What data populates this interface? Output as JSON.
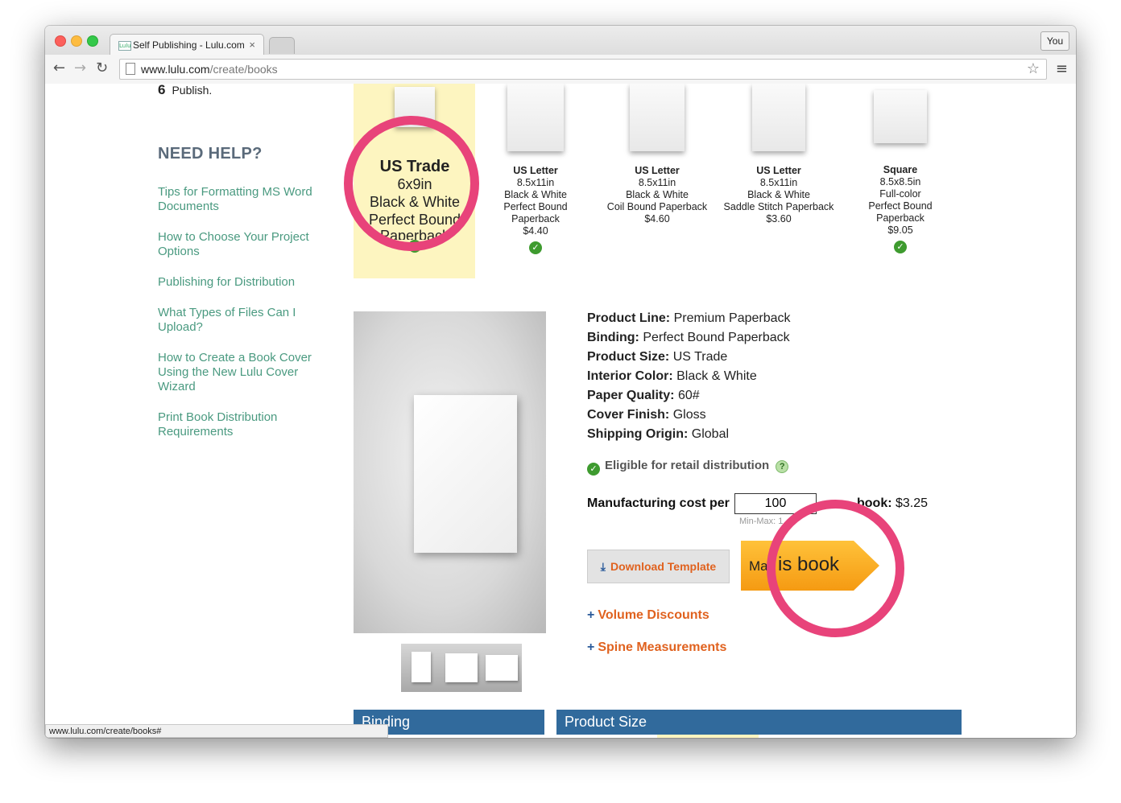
{
  "browser": {
    "tab_title": "Self Publishing - Lulu.com",
    "favicon_text": "Lulu",
    "profile_label": "You",
    "url_host": "www.lulu.com",
    "url_path": "/create/books",
    "status_url": "www.lulu.com/create/books#"
  },
  "steps": {
    "number": "6",
    "label": "Publish."
  },
  "help": {
    "title": "NEED HELP?",
    "links": [
      "Tips for Formatting MS Word Documents",
      "How to Choose Your Project Options",
      "Publishing for Distribution",
      "What Types of Files Can I Upload?",
      "How to Create a Book Cover Using the New Lulu Cover Wizard",
      "Print Book Distribution Requirements"
    ]
  },
  "products": [
    {
      "name": "US Trade",
      "size": "6x9in",
      "color": "Black & White",
      "binding": "Perfect Bound",
      "binding2": "Paperback",
      "price": "",
      "selected": true
    },
    {
      "name": "US Letter",
      "size": "8.5x11in",
      "color": "Black & White",
      "binding": "Perfect Bound",
      "binding2": "Paperback",
      "price": "$4.40"
    },
    {
      "name": "US Letter",
      "size": "8.5x11in",
      "color": "Black & White",
      "binding": "Coil Bound Paperback",
      "binding2": "",
      "price": "$4.60"
    },
    {
      "name": "US Letter",
      "size": "8.5x11in",
      "color": "Black & White",
      "binding": "Saddle Stitch Paperback",
      "binding2": "",
      "price": "$3.60"
    },
    {
      "name": "Square",
      "size": "8.5x8.5in",
      "color": "Full-color",
      "binding": "Perfect Bound",
      "binding2": "Paperback",
      "price": "$9.05"
    }
  ],
  "specs": {
    "product_line_label": "Product Line:",
    "product_line": "Premium Paperback",
    "binding_label": "Binding:",
    "binding": "Perfect Bound Paperback",
    "size_label": "Product Size:",
    "size": "US Trade",
    "interior_label": "Interior Color:",
    "interior": "Black & White",
    "paper_label": "Paper Quality:",
    "paper": "60#",
    "finish_label": "Cover Finish:",
    "finish": "Gloss",
    "origin_label": "Shipping Origin:",
    "origin": "Global"
  },
  "eligible": "Eligible for retail distribution",
  "help_q": "?",
  "cost": {
    "label": "Manufacturing cost per",
    "quantity": "100",
    "minmax": "Min-Max: 1",
    "per_book_label": "book:",
    "per_book_value": "$3.25"
  },
  "buttons": {
    "download_template": "Download Template",
    "make_prefix": "Ma",
    "make_suffix": "is book"
  },
  "links": {
    "volume_discounts": "Volume Discounts",
    "spine_measurements": "Spine Measurements"
  },
  "sections": {
    "binding": "Binding",
    "product_size": "Product Size"
  },
  "colors": {
    "highlight_ring": "#e8437a",
    "accent_orange": "#e0621f",
    "link_green": "#4a9a80",
    "section_blue": "#316a9c",
    "selected_bg": "#fdf5c0"
  }
}
